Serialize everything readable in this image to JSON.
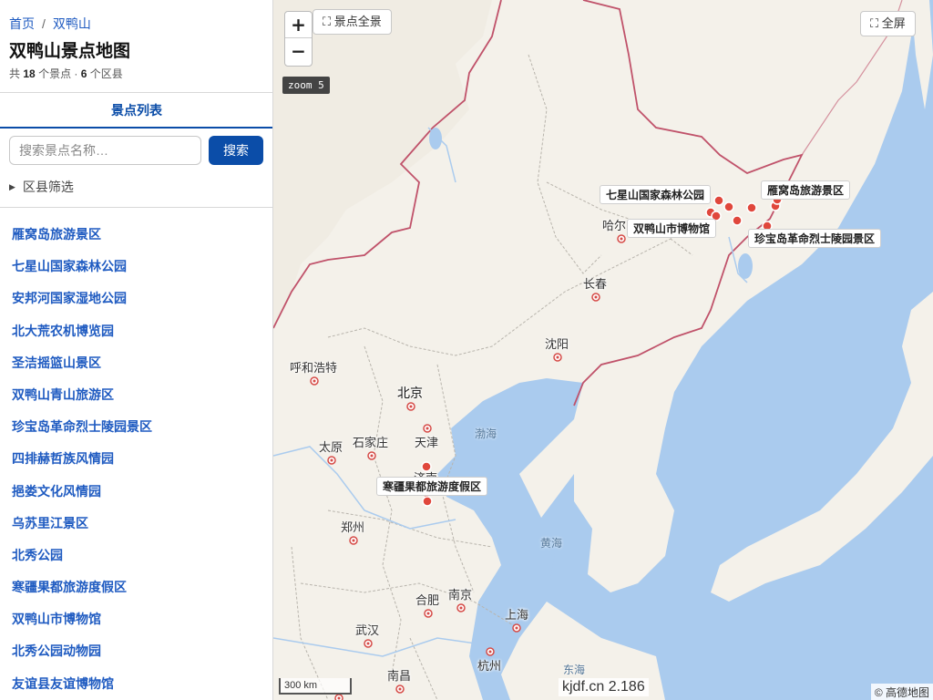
{
  "breadcrumb": {
    "home": "首页",
    "current": "双鸭山"
  },
  "page_title": "双鸭山景点地图",
  "summary": {
    "prefix": "共",
    "spot_count": "18",
    "spot_unit": "个景点 ·",
    "district_count": "6",
    "district_unit": "个区县"
  },
  "tab_label": "景点列表",
  "search": {
    "placeholder": "搜索景点名称…",
    "button": "搜索"
  },
  "filter_label": "区县筛选",
  "poi_list": [
    "雁窝岛旅游景区",
    "七星山国家森林公园",
    "安邦河国家湿地公园",
    "北大荒农机博览园",
    "圣洁摇篮山景区",
    "双鸭山青山旅游区",
    "珍宝岛革命烈士陵园景区",
    "四排赫哲族风情园",
    "挹娄文化风情园",
    "乌苏里江景区",
    "北秀公园",
    "寒疆果都旅游度假区",
    "双鸭山市博物馆",
    "北秀公园动物园",
    "友谊县友谊博物馆"
  ],
  "map": {
    "zoom_in": "+",
    "zoom_out": "−",
    "fit_all": "⛶ 景点全景",
    "fullscreen": "⛶ 全屏",
    "zoom_badge": "zoom 5",
    "scale_label": "300 km",
    "watermark": "kjdf.cn 2.186",
    "attribution": "© 高德地图",
    "cities": {
      "harbin": "哈尔",
      "changchun": "长春",
      "shenyang": "沈阳",
      "hohhot": "呼和浩特",
      "beijing": "北京",
      "tianjin": "天津",
      "shijiazhuang": "石家庄",
      "taiyuan": "太原",
      "jinan": "济南",
      "zhengzhou": "郑州",
      "hefei": "合肥",
      "nanjing": "南京",
      "shanghai": "上海",
      "wuhan": "武汉",
      "hangzhou": "杭州",
      "nanchang": "南昌"
    },
    "seas": {
      "bohai": "渤海",
      "yellow": "黄海",
      "east": "东海"
    },
    "poi_labels": {
      "qixingshan": "七星山国家森林公园",
      "yanwodao": "雁窝岛旅游景区",
      "museum": "双鸭山市博物馆",
      "zhenbaodao": "珍宝岛革命烈士陵园景区",
      "hanjiang": "寒疆果都旅游度假区"
    }
  }
}
